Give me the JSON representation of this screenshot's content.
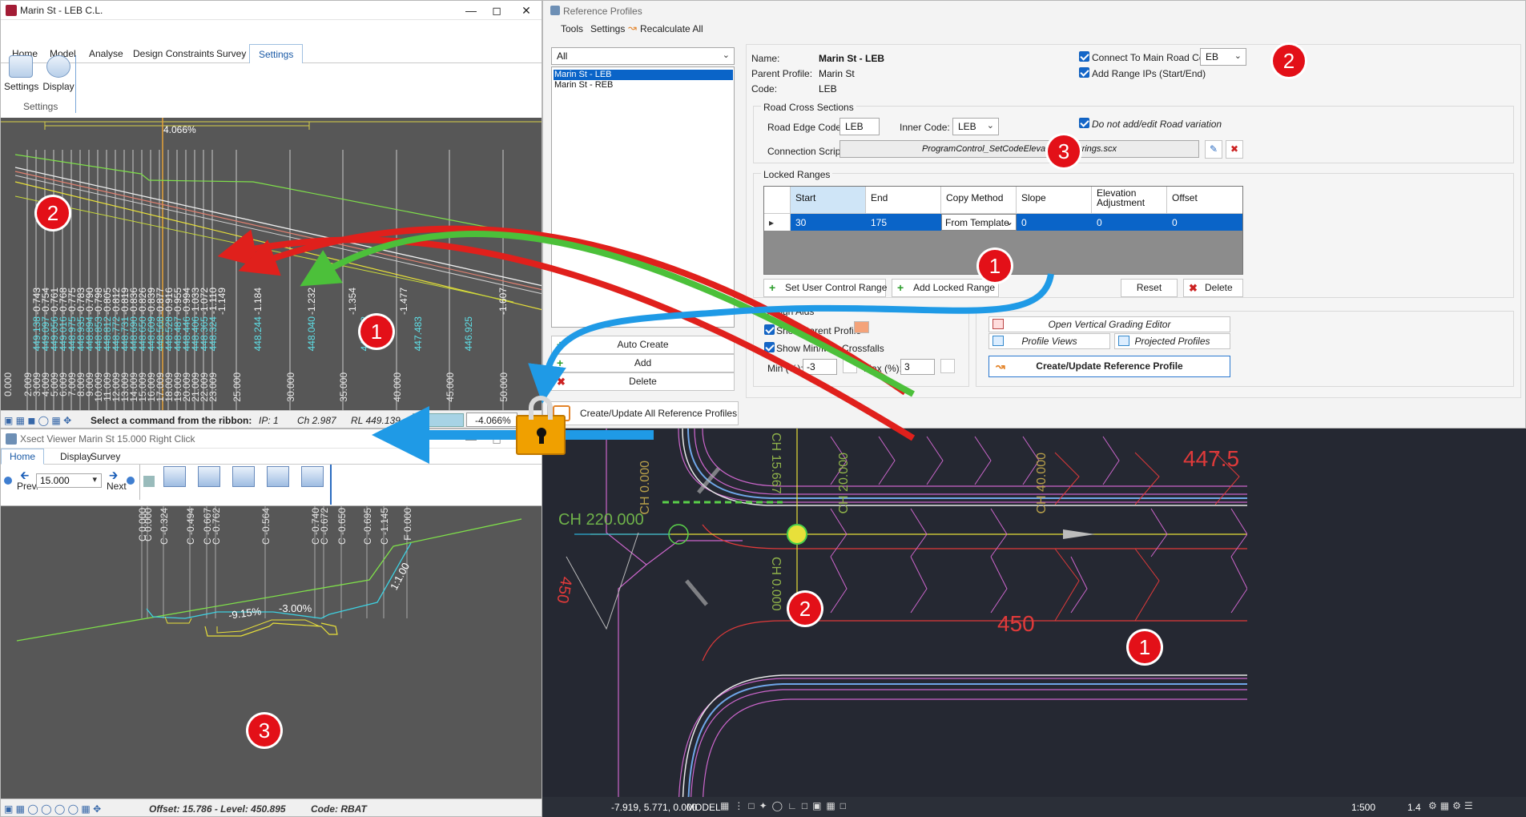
{
  "main_window": {
    "title": "Marin St - LEB C.L.",
    "tabs": [
      "Home",
      "Model",
      "Analyse",
      "Design Constraints",
      "Survey",
      "Settings"
    ],
    "active_tab": "Settings",
    "ribbon_buttons": [
      "Settings",
      "Display"
    ],
    "ribbon_group": "Settings",
    "grade_label": "4.066%",
    "chainages": [
      "0.000",
      "2.009",
      "3.009",
      "4.009",
      "5.009",
      "6.009",
      "7.009",
      "8.009",
      "9.009",
      "10.009",
      "11.009",
      "12.009",
      "13.009",
      "14.009",
      "15.009",
      "16.009",
      "17.009",
      "18.009",
      "19.009",
      "20.009",
      "21.009",
      "22.009",
      "23.009",
      "25.000",
      "30.000",
      "35.000",
      "40.000",
      "45.000",
      "50.000"
    ],
    "levels": [
      "449.138",
      "449.097",
      "449.056",
      "449.016",
      "448.975",
      "448.935",
      "448.894",
      "448.853",
      "448.812",
      "448.772",
      "448.731",
      "448.690",
      "448.650",
      "448.609",
      "448.568",
      "448.528",
      "448.487",
      "448.446",
      "448.406",
      "448.365",
      "448.324",
      "448.244",
      "448.040",
      "447.762",
      "447.483",
      "446.925"
    ],
    "offsets": [
      "-0.743",
      "-0.754",
      "-0.761",
      "-0.768",
      "-0.775",
      "-0.783",
      "-0.790",
      "-0.798",
      "-0.805",
      "-0.812",
      "-0.819",
      "-0.836",
      "-0.826",
      "-0.839",
      "-0.877",
      "-0.916",
      "-0.955",
      "-0.994",
      "-1.033",
      "-1.072",
      "-1.110",
      "-1.149",
      "-1.184",
      "-1.232",
      "-1.354",
      "-1.477",
      "-1.607"
    ],
    "status": {
      "prompt": "Select a command from the ribbon:",
      "ip": "IP: 1",
      "ch": "Ch 2.987",
      "rl": "RL 449.139",
      "grade": "-4.066%"
    }
  },
  "xsect_window": {
    "title": "Xsect Viewer Marin St  15.000  Right Click",
    "tabs": [
      "Home",
      "Display",
      "Survey"
    ],
    "active_tab": "Home",
    "prev_label": "Prev.",
    "next_label": "Next",
    "chainage_value": "15.000",
    "offset_labels": [
      "C 0.000",
      "C 0.000",
      "C -0.324",
      "C -0.494",
      "C -0.667",
      "C -0.762",
      "C -0.564",
      "C -0.740",
      "C -0.672",
      "C -0.650",
      "C -0.695",
      "C -1.145",
      "F 0.000"
    ],
    "slope_labels": [
      "-9.15%",
      "-3.00%",
      "1:1.00"
    ],
    "status": {
      "offset": "Offset: 15.786 - Level: 450.895",
      "code": "Code: RBAT"
    }
  },
  "ref_profiles": {
    "title": "Reference Profiles",
    "menu": [
      "Tools",
      "Settings",
      "Recalculate All"
    ],
    "filter": "All",
    "list_items": [
      "Marin St - LEB",
      "Marin St - REB"
    ],
    "selected_item": "Marin St - LEB",
    "left_buttons": [
      "Auto Create",
      "Add",
      "Delete"
    ],
    "create_all_button": "Create/Update All Reference Profiles",
    "name_label": "Name:",
    "name_value": "Marin St - LEB",
    "parent_label": "Parent Profile:",
    "parent_value": "Marin St",
    "code_label": "Code:",
    "code_value": "LEB",
    "connect_label": "Connect To Main Road Code:",
    "connect_value": "EB",
    "add_range_label": "Add Range IPs (Start/End)",
    "road_cross_sections": "Road Cross Sections",
    "road_edge_label": "Road Edge Code:",
    "road_edge_value": "LEB",
    "inner_label": "Inner Code:",
    "inner_value": "LEB",
    "no_variation_label": "Do not add/edit Road variation",
    "conn_script_label": "Connection Script:",
    "conn_script_value": "ProgramControl_SetCodeElevationsToStrings.scx",
    "locked_ranges": "Locked Ranges",
    "table_headers": [
      "Start",
      "End",
      "Copy Method",
      "Slope",
      "Elevation Adjustment",
      "Offset"
    ],
    "table_row": [
      "30",
      "175",
      "From Template",
      "0",
      "0",
      "0"
    ],
    "range_buttons": [
      "Set User Control Range",
      "Add Locked Range",
      "Reset",
      "Delete"
    ],
    "design_aids": "Design Aids",
    "show_parent_label": "Show Parent Profile",
    "show_minmax_label": "Show Min/Max Crossfalls",
    "min_label": "Min (%):",
    "min_value": "-3",
    "max_label": "Max (%):",
    "max_value": "3",
    "right_buttons": [
      "Open Vertical Grading Editor",
      "Profile Views",
      "Projected Profiles",
      "Create/Update Reference Profile"
    ]
  },
  "plan_view": {
    "labels": [
      "447.5",
      "450",
      "CH 220.000",
      "CH 20.000",
      "CH 40.000",
      "CH 15.667",
      "CH 0.000",
      "CH 0.000",
      "450"
    ],
    "status": {
      "coords": "-7.919, 5.771, 0.000",
      "mode": "MODEL",
      "scale": "1:500",
      "zoom": "1.4"
    }
  },
  "badges": [
    "1",
    "2",
    "3"
  ]
}
